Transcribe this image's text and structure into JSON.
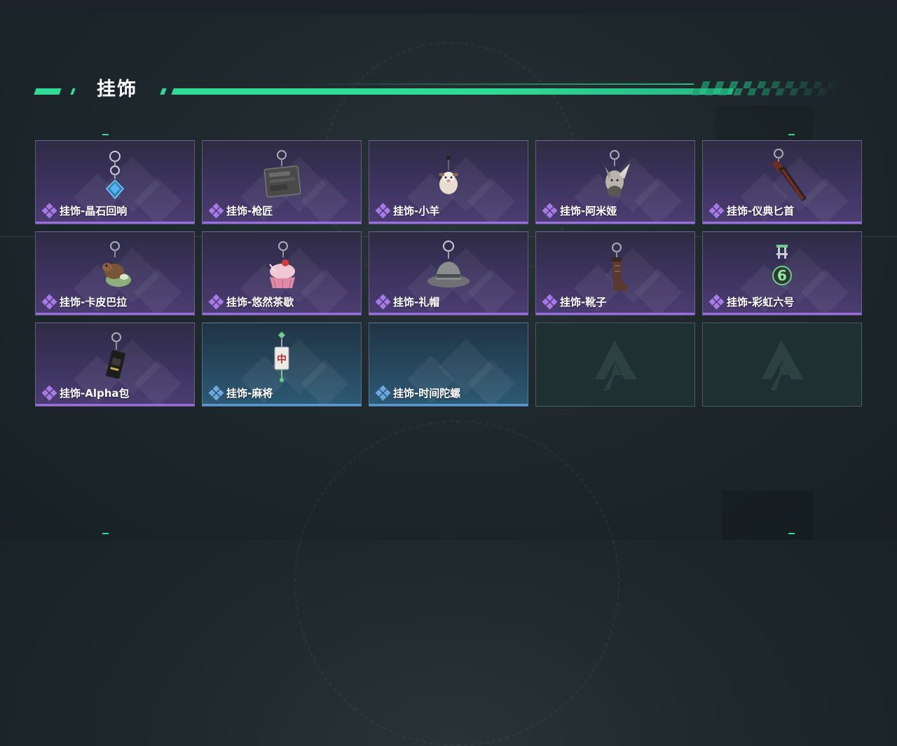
{
  "header": {
    "title": "挂饰"
  },
  "colors": {
    "accent": "#2fdc96",
    "rarity_purple": "#9a6ce0",
    "rarity_blue": "#5a9ad6"
  },
  "items": [
    {
      "label": "挂饰-晶石回响",
      "rarity": "purple",
      "icon": "crystal-charm-icon"
    },
    {
      "label": "挂饰-枪匠",
      "rarity": "purple",
      "icon": "gunsmith-charm-icon"
    },
    {
      "label": "挂饰-小羊",
      "rarity": "purple",
      "icon": "lamb-charm-icon"
    },
    {
      "label": "挂饰-阿米娅",
      "rarity": "purple",
      "icon": "amiya-charm-icon"
    },
    {
      "label": "挂饰-仪典匕首",
      "rarity": "purple",
      "icon": "ritual-dagger-charm-icon"
    },
    {
      "label": "挂饰-卡皮巴拉",
      "rarity": "purple",
      "icon": "capybara-charm-icon"
    },
    {
      "label": "挂饰-悠然茶歇",
      "rarity": "purple",
      "icon": "cupcake-charm-icon"
    },
    {
      "label": "挂饰-礼帽",
      "rarity": "purple",
      "icon": "hat-charm-icon"
    },
    {
      "label": "挂饰-靴子",
      "rarity": "purple",
      "icon": "boot-charm-icon"
    },
    {
      "label": "挂饰-彩虹六号",
      "rarity": "purple",
      "icon": "rainbow-six-charm-icon"
    },
    {
      "label": "挂饰-Alpha包",
      "rarity": "purple",
      "icon": "alpha-bag-charm-icon"
    },
    {
      "label": "挂饰-麻将",
      "rarity": "blue",
      "icon": "mahjong-charm-icon"
    },
    {
      "label": "挂饰-时间陀螺",
      "rarity": "blue",
      "icon": "time-gyro-charm-icon"
    }
  ],
  "empty_slots": [
    {
      "icon": "locked-slot-logo-icon"
    },
    {
      "icon": "locked-slot-logo-icon"
    }
  ]
}
